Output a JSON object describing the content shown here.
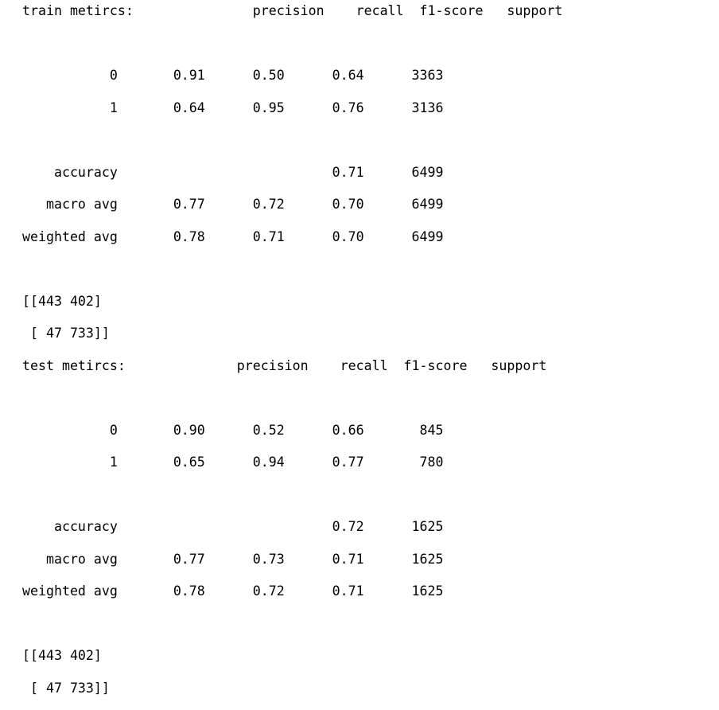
{
  "output_lines": [
    "train metircs:               precision    recall  f1-score   support",
    "",
    "           0       0.91      0.50      0.64      3363",
    "           1       0.64      0.95      0.76      3136",
    "",
    "    accuracy                           0.71      6499",
    "   macro avg       0.77      0.72      0.70      6499",
    "weighted avg       0.78      0.71      0.70      6499",
    "",
    "[[443 402]",
    " [ 47 733]]",
    "test metircs:              precision    recall  f1-score   support",
    "",
    "           0       0.90      0.52      0.66       845",
    "           1       0.65      0.94      0.77       780",
    "",
    "    accuracy                           0.72      1625",
    "   macro avg       0.77      0.73      0.71      1625",
    "weighted avg       0.78      0.72      0.71      1625",
    "",
    "[[443 402]",
    " [ 47 733]]"
  ]
}
